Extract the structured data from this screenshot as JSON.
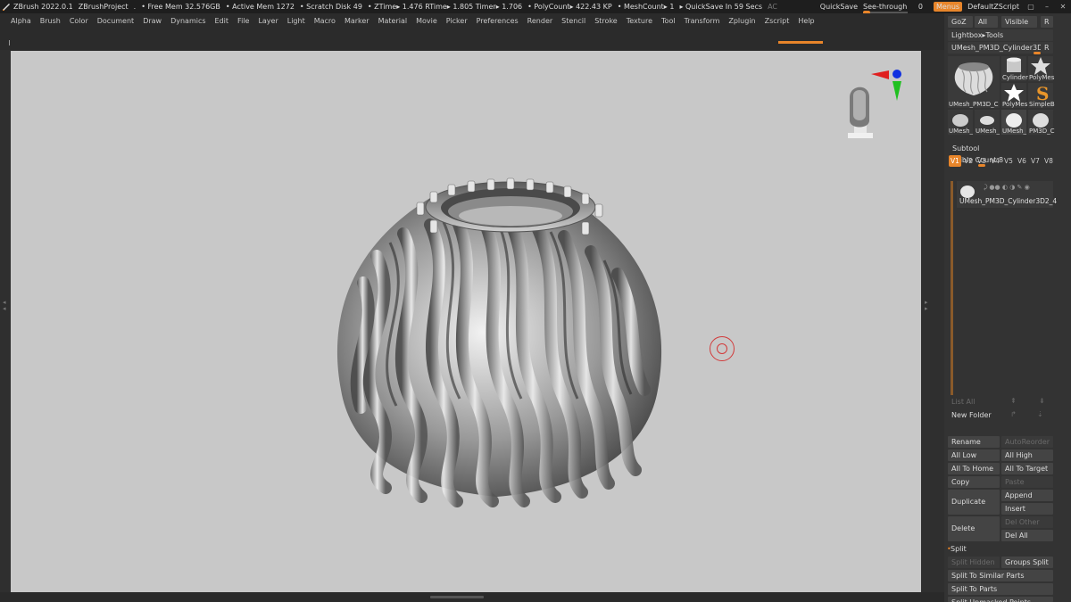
{
  "titlebar": {
    "app": "ZBrush 2022.0.1",
    "project": "ZBrushProject",
    "dot": ".",
    "free_mem": "• Free Mem 32.576GB",
    "active_mem": "• Active Mem 1272",
    "scratch": "• Scratch Disk 49",
    "ztime": "• ZTime▸ 1.476 RTime▸ 1.805 Timer▸ 1.706",
    "polycount": "• PolyCount▸ 422.43 KP",
    "meshcount": "• MeshCount▸ 1",
    "quicksave_in": "▸ QuickSave In 59 Secs",
    "ac": "AC",
    "quicksave": "QuickSave",
    "see_through_label": "See-through",
    "see_through_value": "0",
    "menus": "Menus",
    "default_zscript": "DefaultZScript"
  },
  "menubar": [
    "Alpha",
    "Brush",
    "Color",
    "Document",
    "Draw",
    "Dynamics",
    "Edit",
    "File",
    "Layer",
    "Light",
    "Macro",
    "Marker",
    "Material",
    "Movie",
    "Picker",
    "Preferences",
    "Render",
    "Stencil",
    "Stroke",
    "Texture",
    "Tool",
    "Transform",
    "Zplugin",
    "Zscript",
    "Help"
  ],
  "right_panel": {
    "goz": "GoZ",
    "all": "All",
    "visible": "Visible",
    "r": "R",
    "lightbox": "Lightbox▸Tools",
    "current_tool": "UMesh_PM3D_Cylinder3D2_4",
    "current_tool_r": "R",
    "tools": [
      {
        "name": "UMesh_PM3D_C"
      },
      {
        "name": "Cylinder"
      },
      {
        "name": "PolyMes"
      },
      {
        "name": "PolyMes"
      },
      {
        "name": "SimpleB"
      },
      {
        "name": "UMesh_"
      },
      {
        "name": "UMesh_"
      },
      {
        "name": "UMesh_"
      },
      {
        "name": "PM3D_C"
      }
    ],
    "subtool_header": "Subtool",
    "visible_count": "Visible Count 8",
    "vtabs": [
      "V1",
      "V2",
      "V3",
      "V4",
      "V5",
      "V6",
      "V7",
      "V8"
    ],
    "subtool_item": "UMesh_PM3D_Cylinder3D2_4",
    "list_all": "List All",
    "new_folder": "New Folder",
    "rename": "Rename",
    "auto_reorder": "AutoReorder",
    "all_low": "All Low",
    "all_high": "All High",
    "all_to_home": "All To Home",
    "all_to_target": "All To Target",
    "copy": "Copy",
    "paste": "Paste",
    "duplicate": "Duplicate",
    "append": "Append",
    "insert": "Insert",
    "delete": "Delete",
    "del_other": "Del Other",
    "del_all": "Del All",
    "split_header": "Split",
    "split_hidden": "Split Hidden",
    "groups_split": "Groups Split",
    "split_similar": "Split To Similar Parts",
    "split_parts": "Split To Parts",
    "split_unmasked": "Split Unmasked Points"
  },
  "colors": {
    "accent": "#e8852a",
    "canvas_bg": "#c8c8c8",
    "panel_bg": "#333333"
  }
}
